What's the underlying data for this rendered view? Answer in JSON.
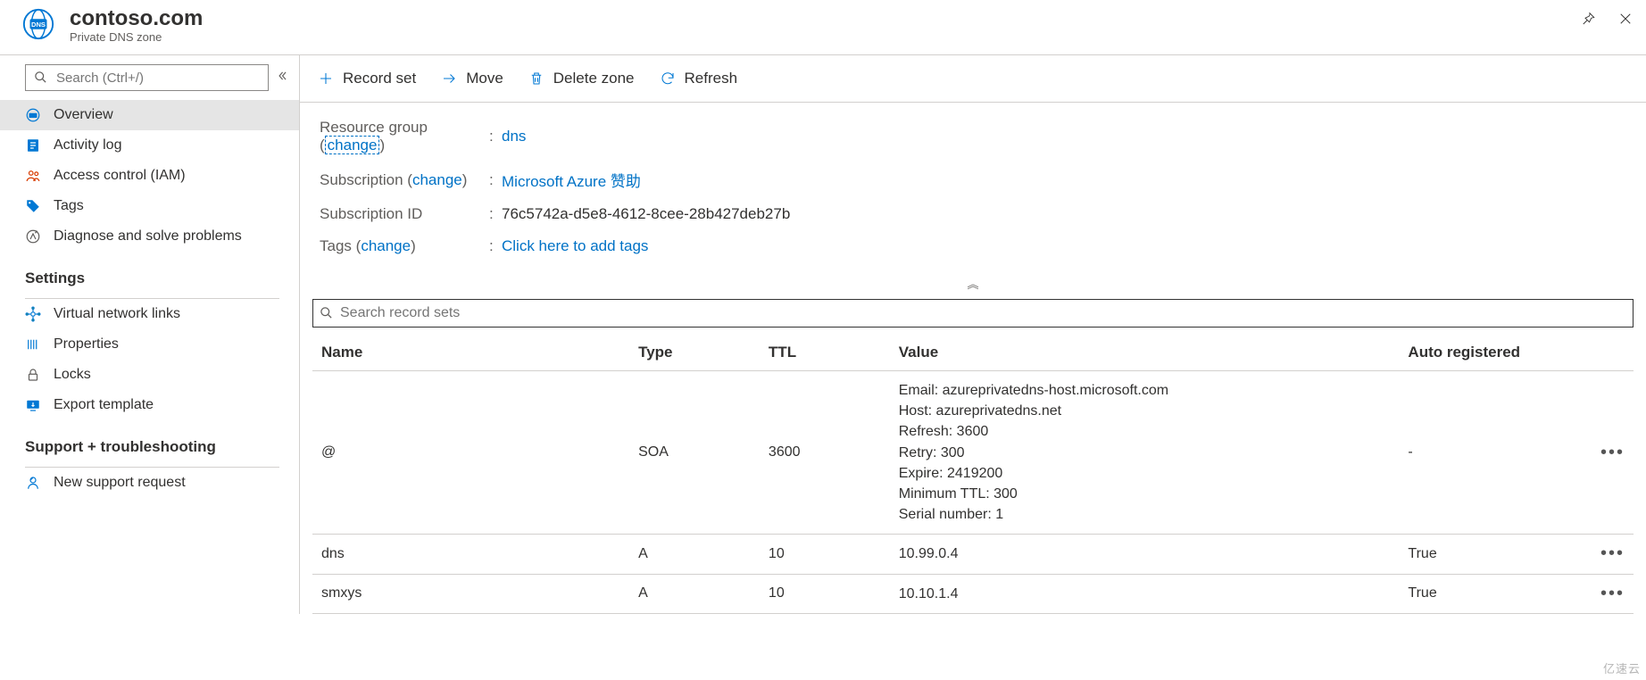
{
  "header": {
    "title": "contoso.com",
    "subtitle": "Private DNS zone"
  },
  "side": {
    "search_placeholder": "Search (Ctrl+/)",
    "items": [
      {
        "icon": "dns",
        "label": "Overview",
        "selected": true
      },
      {
        "icon": "log",
        "label": "Activity log"
      },
      {
        "icon": "iam",
        "label": "Access control (IAM)"
      },
      {
        "icon": "tag",
        "label": "Tags"
      },
      {
        "icon": "diag",
        "label": "Diagnose and solve problems"
      }
    ],
    "settings_title": "Settings",
    "settings": [
      {
        "icon": "vnet",
        "label": "Virtual network links"
      },
      {
        "icon": "prop",
        "label": "Properties"
      },
      {
        "icon": "lock",
        "label": "Locks"
      },
      {
        "icon": "export",
        "label": "Export template"
      }
    ],
    "support_title": "Support + troubleshooting",
    "support": [
      {
        "icon": "support",
        "label": "New support request"
      }
    ]
  },
  "toolbar": {
    "record_set": "Record set",
    "move": "Move",
    "delete_zone": "Delete zone",
    "refresh": "Refresh"
  },
  "props": {
    "rg_label": "Resource group",
    "rg_change": "change",
    "rg_value": "dns",
    "sub_label": "Subscription",
    "sub_change": "change",
    "sub_value": "Microsoft Azure 赞助",
    "subid_label": "Subscription ID",
    "subid_value": "76c5742a-d5e8-4612-8cee-28b427deb27b",
    "tags_label": "Tags",
    "tags_change": "change",
    "tags_value": "Click here to add tags"
  },
  "records": {
    "search_placeholder": "Search record sets",
    "headers": {
      "name": "Name",
      "type": "Type",
      "ttl": "TTL",
      "value": "Value",
      "auto": "Auto registered"
    },
    "rows": [
      {
        "name": "@",
        "type": "SOA",
        "ttl": "3600",
        "value_lines": [
          "Email: azureprivatedns-host.microsoft.com",
          "Host: azureprivatedns.net",
          "Refresh: 3600",
          "Retry: 300",
          "Expire: 2419200",
          "Minimum TTL: 300",
          "Serial number: 1"
        ],
        "auto": "-"
      },
      {
        "name": "dns",
        "type": "A",
        "ttl": "10",
        "value_lines": [
          "10.99.0.4"
        ],
        "auto": "True"
      },
      {
        "name": "smxys",
        "type": "A",
        "ttl": "10",
        "value_lines": [
          "10.10.1.4"
        ],
        "auto": "True"
      }
    ]
  },
  "watermark": "亿速云"
}
